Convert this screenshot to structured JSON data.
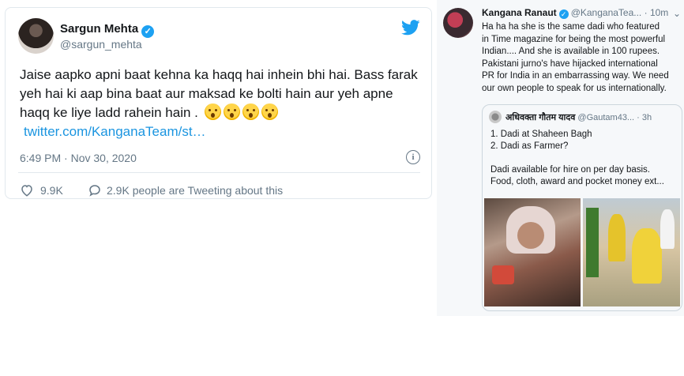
{
  "left_tweet": {
    "author_name": "Sargun Mehta",
    "author_handle": "@sargun_mehta",
    "text": "Jaise aapko apni baat kehna ka haqq hai inhein bhi hai. Bass farak yeh hai ki aap bina baat aur maksad ke bolti hain aur yeh apne haqq ke liye ladd rahein hain .",
    "emojis": [
      "hushed-face",
      "hushed-face",
      "hushed-face",
      "hushed-face"
    ],
    "link": "twitter.com/KanganaTeam/st…",
    "timestamp": "6:49 PM · Nov 30, 2020",
    "likes": "9.9K",
    "replies_label": "2.9K people are Tweeting about this",
    "icons": [
      "verified-icon",
      "twitter-bird-icon",
      "info-icon",
      "heart-icon",
      "reply-bubble-icon"
    ],
    "accent": "#1da1f2"
  },
  "right_tweet": {
    "author_name": "Kangana Ranaut",
    "author_handle": "@KanganaTea...",
    "time": "· 10m",
    "menu": "⌄",
    "text_lines": [
      "Ha ha ha she is the same dadi who featured",
      "in Time magazine for being the most powerful",
      "Indian.... And she is available in 100 rupees.",
      "Pakistani jurno's have hijacked international",
      "PR for India in an embarrassing way. We need",
      "our own people to speak for us internationally."
    ],
    "quote": {
      "author_name": "अधिवक्ता गौतम यादव",
      "author_handle": "@Gautam43...",
      "time": "· 3h",
      "lines": [
        "1. Dadi at Shaheen Bagh",
        "2. Dadi as Farmer?",
        "Dadi available for hire on per day basis.",
        "Food, cloth, award and pocket money ext..."
      ]
    }
  }
}
